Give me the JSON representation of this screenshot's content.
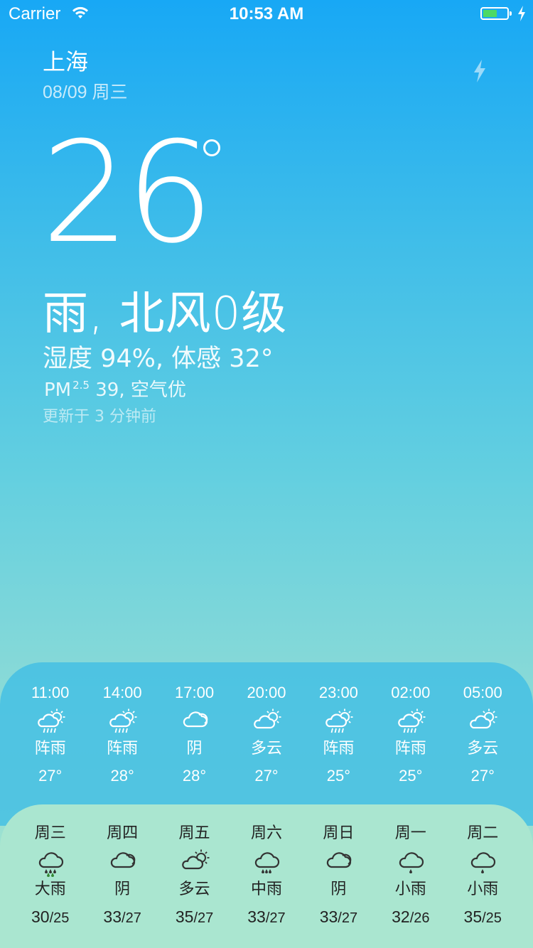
{
  "status_bar": {
    "carrier": "Carrier",
    "time": "10:53 AM",
    "battery_level": 0.6
  },
  "header": {
    "city": "上海",
    "date": "08/09 周三"
  },
  "current": {
    "temperature": "26",
    "condition": "雨, 北风0级",
    "humidity_line": "湿度 94%, 体感 32°",
    "pm_prefix": "PM",
    "pm_sup": "2.5",
    "pm_value": "39, 空气优",
    "updated": "更新于 3 分钟前"
  },
  "hourly": [
    {
      "time": "11:00",
      "icon": "rain-sun-icon",
      "desc": "阵雨",
      "temp": "27°"
    },
    {
      "time": "14:00",
      "icon": "rain-sun-icon",
      "desc": "阵雨",
      "temp": "28°"
    },
    {
      "time": "17:00",
      "icon": "cloud-icon",
      "desc": "阴",
      "temp": "28°"
    },
    {
      "time": "20:00",
      "icon": "partly-cloudy-icon",
      "desc": "多云",
      "temp": "27°"
    },
    {
      "time": "23:00",
      "icon": "rain-sun-icon",
      "desc": "阵雨",
      "temp": "25°"
    },
    {
      "time": "02:00",
      "icon": "rain-sun-icon",
      "desc": "阵雨",
      "temp": "25°"
    },
    {
      "time": "05:00",
      "icon": "partly-cloudy-icon",
      "desc": "多云",
      "temp": "27°"
    }
  ],
  "daily": [
    {
      "day": "周三",
      "icon": "heavy-rain-icon",
      "desc": "大雨",
      "high": "30",
      "low": "/25"
    },
    {
      "day": "周四",
      "icon": "cloud-icon",
      "desc": "阴",
      "high": "33",
      "low": "/27"
    },
    {
      "day": "周五",
      "icon": "partly-cloudy-icon",
      "desc": "多云",
      "high": "35",
      "low": "/27"
    },
    {
      "day": "周六",
      "icon": "moderate-rain-icon",
      "desc": "中雨",
      "high": "33",
      "low": "/27"
    },
    {
      "day": "周日",
      "icon": "cloud-icon",
      "desc": "阴",
      "high": "33",
      "low": "/27"
    },
    {
      "day": "周一",
      "icon": "light-rain-icon",
      "desc": "小雨",
      "high": "32",
      "low": "/26"
    },
    {
      "day": "周二",
      "icon": "light-rain-icon",
      "desc": "小雨",
      "high": "35",
      "low": "/25"
    }
  ]
}
